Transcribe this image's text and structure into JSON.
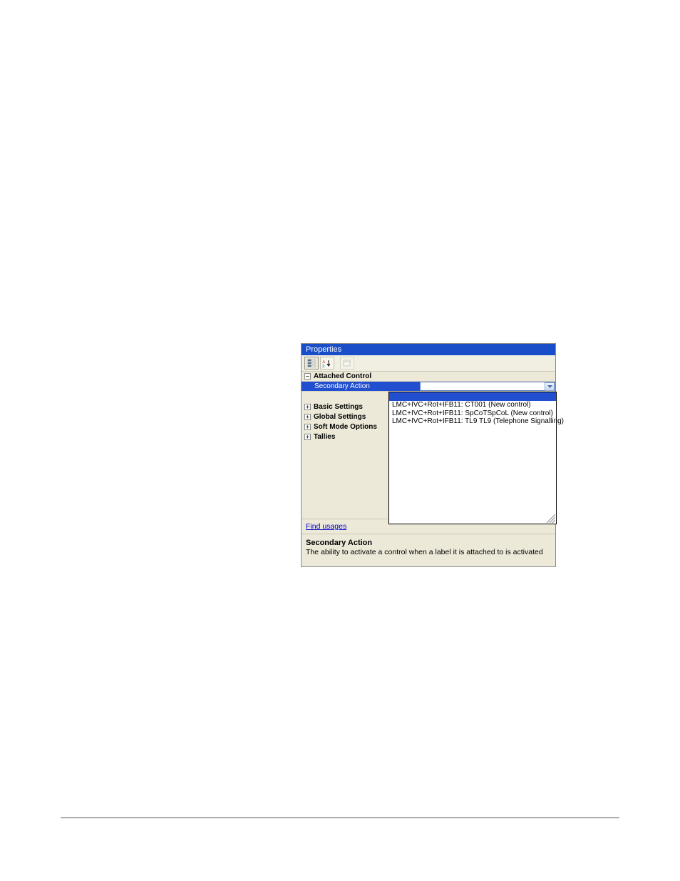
{
  "window": {
    "title": "Properties"
  },
  "toolbar": {
    "categorized_icon": "categorized",
    "sort_icon": "A↓",
    "pages_icon": "pages"
  },
  "categories": [
    {
      "label": "Attached Control",
      "expanded": true
    },
    {
      "label": "Basic Settings",
      "expanded": false
    },
    {
      "label": "Global Settings",
      "expanded": false
    },
    {
      "label": "Soft Mode Options",
      "expanded": false
    },
    {
      "label": "Tallies",
      "expanded": false
    }
  ],
  "selected_property": {
    "label": "Secondary Action",
    "value": ""
  },
  "dropdown_options": [
    "LMC+IVC+Rot+IFB11: CT001      (New control)",
    "LMC+IVC+Rot+IFB11: SpCoTSpCoL (New control)",
    "LMC+IVC+Rot+IFB11: TL9  TL9   (Telephone Signalling)"
  ],
  "find_usages_label": "Find usages",
  "description": {
    "title": "Secondary Action",
    "text": "The ability to activate a control when a label it is attached to is activated"
  }
}
